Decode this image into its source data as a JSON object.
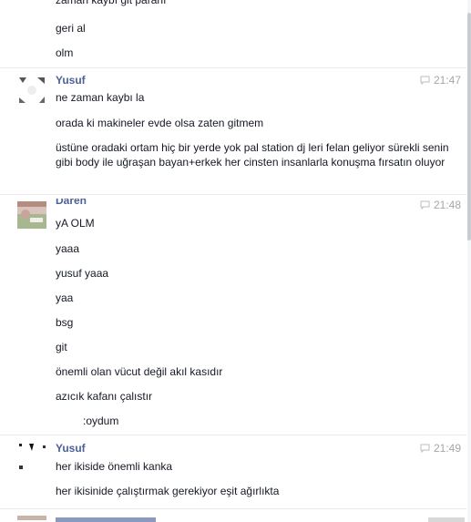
{
  "chat": {
    "top_fragment": "zaman kaybı git paranı",
    "pre_messages": [
      "geri al",
      "olm"
    ],
    "groups": [
      {
        "sender": "Yusuf",
        "time": "21:47",
        "messages": [
          "ne zaman kaybı la",
          "orada ki makineler evde olsa zaten gitmem",
          "üstüne oradaki ortam hiç bir yerde yok pal station dj leri felan geliyor sürekli senin gibi body ile uğraşan bayan+erkek her cinsten insanlarla konuşma fırsatın oluyor"
        ]
      },
      {
        "sender": "Daren",
        "time": "21:48",
        "messages": [
          "yA OLM",
          "yaaa",
          "yusuf yaaa",
          "yaa",
          "bsg",
          "git",
          "önemli olan vücut değil akıl kasıdır",
          "azıcık kafanı çalıstır",
          ":oydum"
        ]
      },
      {
        "sender": "Yusuf",
        "time": "21:49",
        "messages": [
          "her ikiside önemli kanka",
          "her ikisinide çalıştırmak gerekiyor eşit ağırlıkta"
        ]
      }
    ]
  },
  "colors": {
    "sender": "#4b6298",
    "time": "#a6a6a6",
    "text": "#141823",
    "divider": "#e9ebee"
  },
  "icons": {
    "timestamp": "chat-bubble-icon"
  }
}
